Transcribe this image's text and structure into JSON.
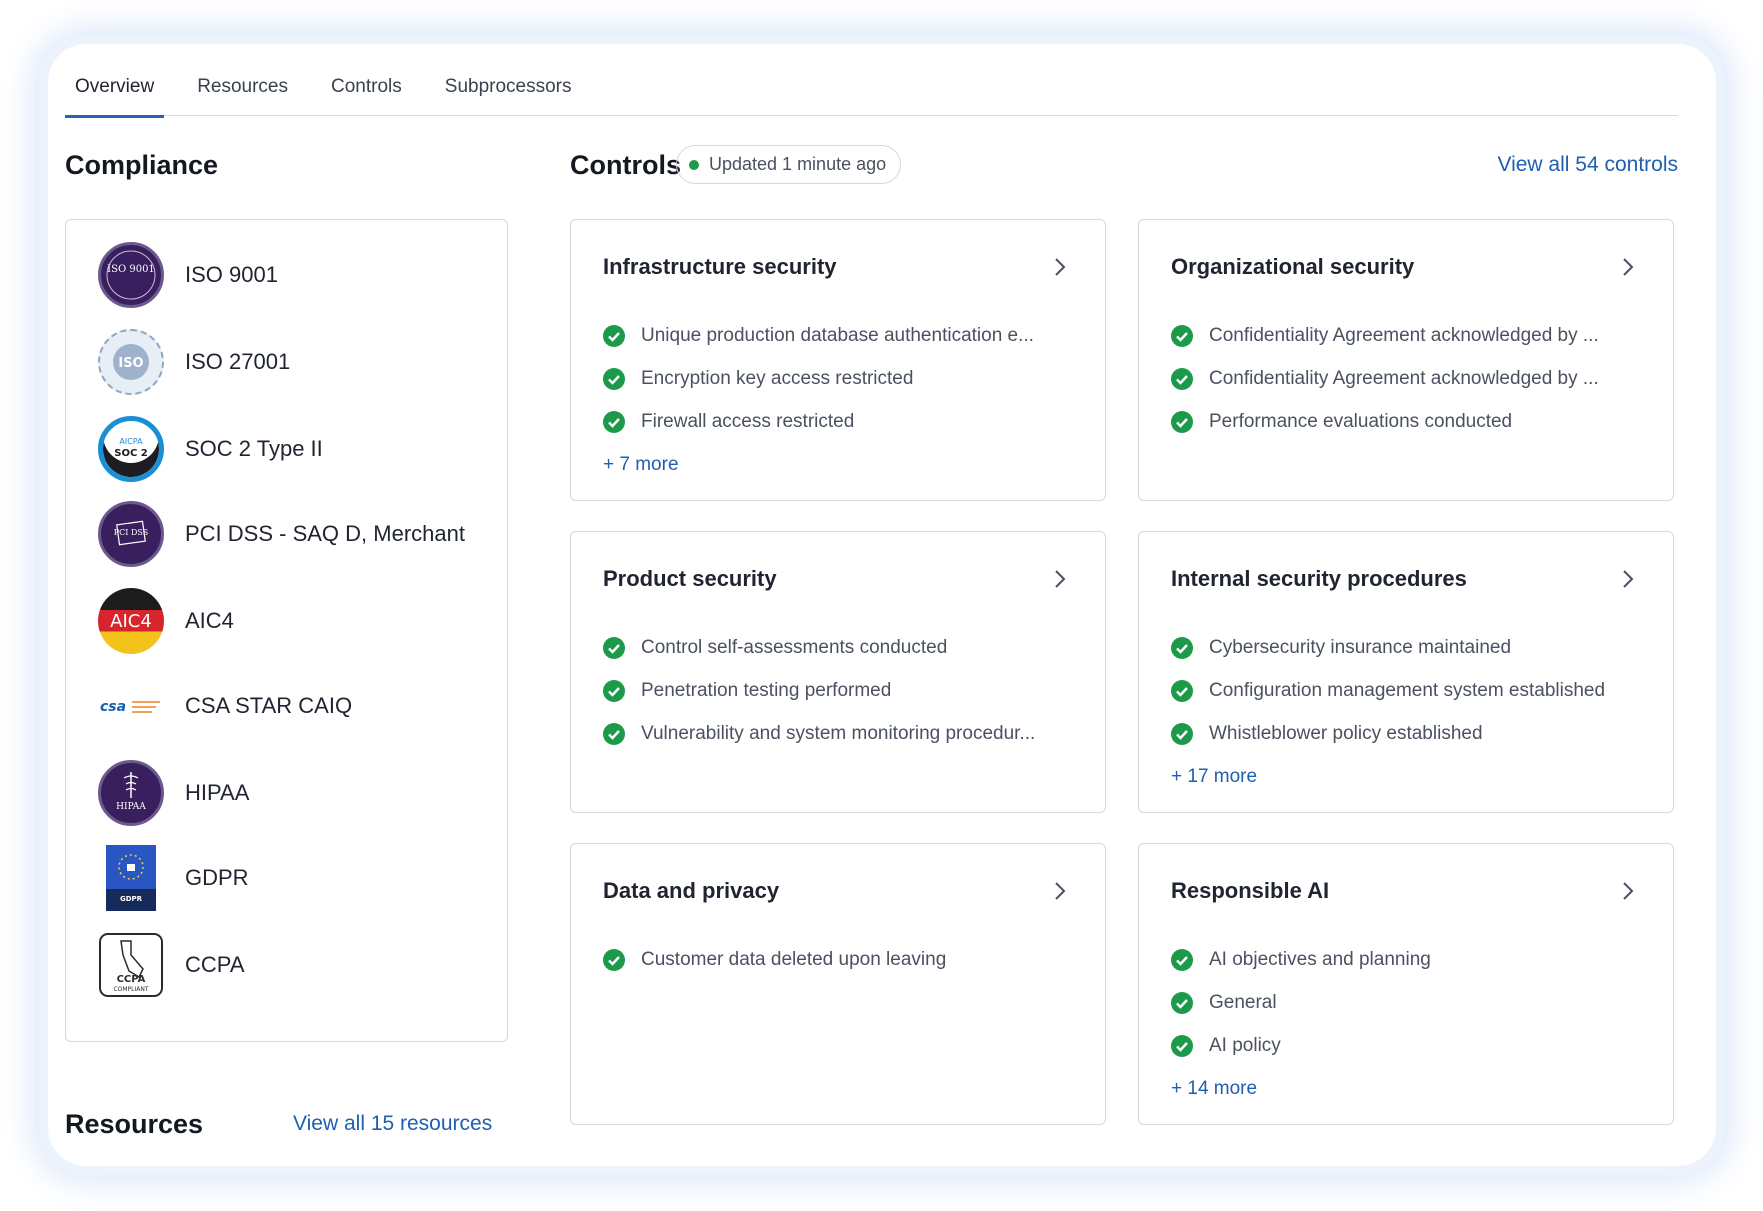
{
  "tabs": [
    {
      "label": "Overview",
      "active": true
    },
    {
      "label": "Resources",
      "active": false
    },
    {
      "label": "Controls",
      "active": false
    },
    {
      "label": "Subprocessors",
      "active": false
    }
  ],
  "compliance": {
    "title": "Compliance",
    "items": [
      {
        "label": "ISO 9001",
        "icon": "iso-9001-badge-icon"
      },
      {
        "label": "ISO 27001",
        "icon": "iso-27001-badge-icon"
      },
      {
        "label": "SOC 2 Type II",
        "icon": "aicpa-soc2-badge-icon"
      },
      {
        "label": "PCI DSS - SAQ D, Merchant",
        "icon": "pci-dss-badge-icon"
      },
      {
        "label": "AIC4",
        "icon": "aic4-badge-icon"
      },
      {
        "label": "CSA STAR CAIQ",
        "icon": "csa-star-logo-icon"
      },
      {
        "label": "HIPAA",
        "icon": "hipaa-badge-icon"
      },
      {
        "label": "GDPR",
        "icon": "gdpr-badge-icon"
      },
      {
        "label": "CCPA",
        "icon": "ccpa-badge-icon"
      }
    ],
    "badge_text": {
      "iso9001": "ISO 9001",
      "iso27001": "ISO",
      "soc_top": "AICPA",
      "soc_main": "SOC 2",
      "pci": "PCI DSS",
      "aic4": "AIC4",
      "csa": "csa",
      "hipaa": "HIPAA",
      "gdpr": "GDPR",
      "ccpa": "CCPA",
      "ccpa_sub": "COMPLIANT"
    }
  },
  "resources": {
    "title": "Resources",
    "view_all": "View all 15 resources"
  },
  "controls": {
    "title": "Controls",
    "status": "Updated 1 minute ago",
    "view_all": "View all 54 controls",
    "cards": [
      {
        "title": "Infrastructure security",
        "items": [
          "Unique production database authentication e...",
          "Encryption key access restricted",
          "Firewall access restricted"
        ],
        "more": "+ 7 more"
      },
      {
        "title": "Organizational security",
        "items": [
          "Confidentiality Agreement acknowledged by ...",
          "Confidentiality Agreement acknowledged by ...",
          "Performance evaluations conducted"
        ],
        "more": ""
      },
      {
        "title": "Product security",
        "items": [
          "Control self-assessments conducted",
          "Penetration testing performed",
          "Vulnerability and system monitoring procedur..."
        ],
        "more": ""
      },
      {
        "title": "Internal security procedures",
        "items": [
          "Cybersecurity insurance maintained",
          "Configuration management system established",
          "Whistleblower policy established"
        ],
        "more": "+ 17 more"
      },
      {
        "title": "Data and privacy",
        "items": [
          "Customer data deleted upon leaving"
        ],
        "more": ""
      },
      {
        "title": "Responsible AI",
        "items": [
          "AI objectives and planning",
          "General",
          "AI policy"
        ],
        "more": "+ 14 more"
      }
    ]
  },
  "colors": {
    "accent": "#2463b5",
    "link": "#1f5fb0",
    "check": "#1c9a4a",
    "border": "#d3d7de"
  }
}
